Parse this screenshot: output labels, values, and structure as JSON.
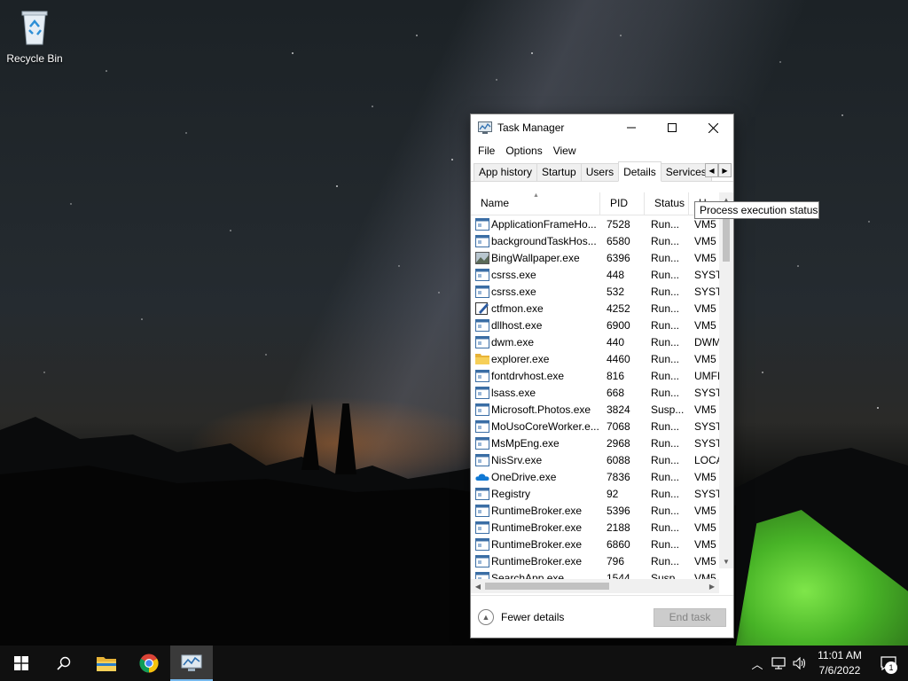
{
  "desktop": {
    "recycle_bin_label": "Recycle Bin"
  },
  "window": {
    "title": "Task Manager",
    "menu": [
      "File",
      "Options",
      "View"
    ],
    "tabs": [
      "App history",
      "Startup",
      "Users",
      "Details",
      "Services"
    ],
    "active_tab": "Details",
    "columns": {
      "name": "Name",
      "pid": "PID",
      "status": "Status",
      "user": "U"
    },
    "rows": [
      {
        "name": "ApplicationFrameHo...",
        "pid": "7528",
        "status": "Run...",
        "user": "VM5",
        "icon": "app-generic-icon"
      },
      {
        "name": "backgroundTaskHos...",
        "pid": "6580",
        "status": "Run...",
        "user": "VM5",
        "icon": "app-generic-icon"
      },
      {
        "name": "BingWallpaper.exe",
        "pid": "6396",
        "status": "Run...",
        "user": "VM5",
        "icon": "wallpaper-icon"
      },
      {
        "name": "csrss.exe",
        "pid": "448",
        "status": "Run...",
        "user": "SYSTE",
        "icon": "app-generic-icon"
      },
      {
        "name": "csrss.exe",
        "pid": "532",
        "status": "Run...",
        "user": "SYSTE",
        "icon": "app-generic-icon"
      },
      {
        "name": "ctfmon.exe",
        "pid": "4252",
        "status": "Run...",
        "user": "VM5",
        "icon": "pen-icon"
      },
      {
        "name": "dllhost.exe",
        "pid": "6900",
        "status": "Run...",
        "user": "VM5",
        "icon": "app-generic-icon"
      },
      {
        "name": "dwm.exe",
        "pid": "440",
        "status": "Run...",
        "user": "DWM",
        "icon": "app-generic-icon"
      },
      {
        "name": "explorer.exe",
        "pid": "4460",
        "status": "Run...",
        "user": "VM5",
        "icon": "folder-icon"
      },
      {
        "name": "fontdrvhost.exe",
        "pid": "816",
        "status": "Run...",
        "user": "UMFD",
        "icon": "app-generic-icon"
      },
      {
        "name": "lsass.exe",
        "pid": "668",
        "status": "Run...",
        "user": "SYSTE",
        "icon": "app-generic-icon"
      },
      {
        "name": "Microsoft.Photos.exe",
        "pid": "3824",
        "status": "Susp...",
        "user": "VM5",
        "icon": "app-generic-icon"
      },
      {
        "name": "MoUsoCoreWorker.e...",
        "pid": "7068",
        "status": "Run...",
        "user": "SYSTE",
        "icon": "app-generic-icon"
      },
      {
        "name": "MsMpEng.exe",
        "pid": "2968",
        "status": "Run...",
        "user": "SYSTE",
        "icon": "app-generic-icon"
      },
      {
        "name": "NisSrv.exe",
        "pid": "6088",
        "status": "Run...",
        "user": "LOCA",
        "icon": "app-generic-icon"
      },
      {
        "name": "OneDrive.exe",
        "pid": "7836",
        "status": "Run...",
        "user": "VM5",
        "icon": "cloud-icon"
      },
      {
        "name": "Registry",
        "pid": "92",
        "status": "Run...",
        "user": "SYSTE",
        "icon": "app-generic-icon"
      },
      {
        "name": "RuntimeBroker.exe",
        "pid": "5396",
        "status": "Run...",
        "user": "VM5",
        "icon": "app-generic-icon"
      },
      {
        "name": "RuntimeBroker.exe",
        "pid": "2188",
        "status": "Run...",
        "user": "VM5",
        "icon": "app-generic-icon"
      },
      {
        "name": "RuntimeBroker.exe",
        "pid": "6860",
        "status": "Run...",
        "user": "VM5",
        "icon": "app-generic-icon"
      },
      {
        "name": "RuntimeBroker.exe",
        "pid": "796",
        "status": "Run...",
        "user": "VM5",
        "icon": "app-generic-icon"
      },
      {
        "name": "SearchApp.exe",
        "pid": "1544",
        "status": "Susp...",
        "user": "VM5",
        "icon": "app-generic-icon"
      }
    ],
    "tooltip": "Process execution status",
    "fewer_details_label": "Fewer details",
    "end_task_label": "End task"
  },
  "taskbar": {
    "time": "11:01 AM",
    "date": "7/6/2022",
    "notification_count": "1"
  },
  "colors": {
    "accent": "#76b9ed",
    "taskbar": "#101010"
  }
}
